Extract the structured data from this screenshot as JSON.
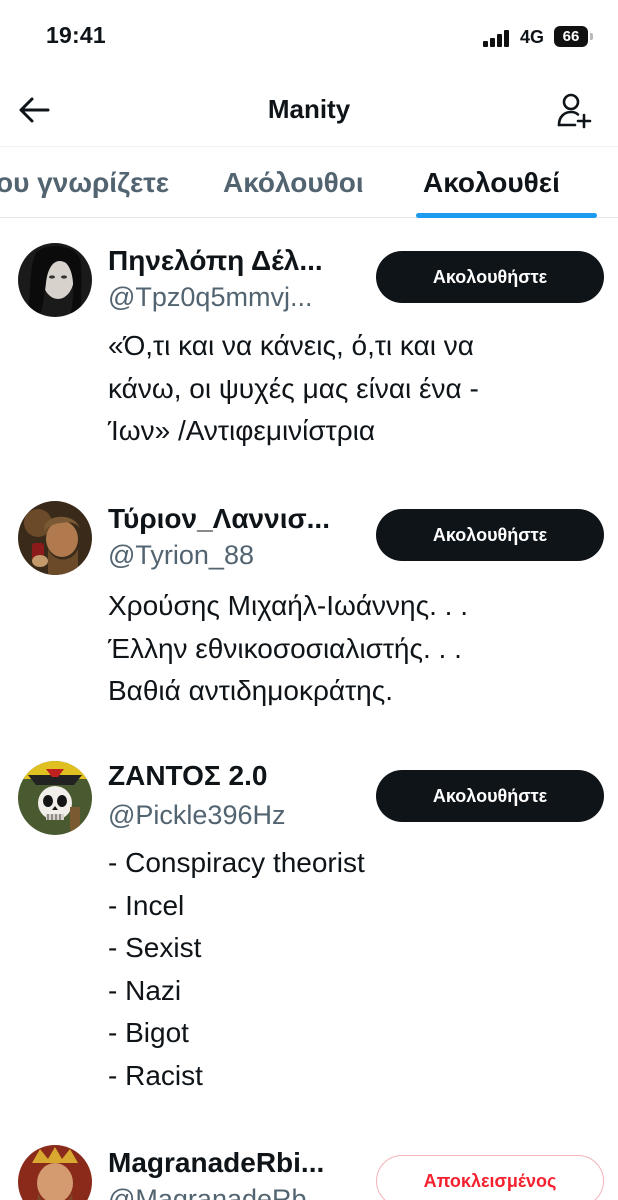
{
  "status_bar": {
    "time": "19:41",
    "network": "4G",
    "battery": "66"
  },
  "header": {
    "title": "Manity",
    "back_icon": "arrow-left-icon",
    "add_icon": "add-user-icon"
  },
  "tabs": [
    {
      "label": "ου γνωρίζετε",
      "active": false
    },
    {
      "label": "Ακόλουθοι",
      "active": false
    },
    {
      "label": "Ακολουθεί",
      "active": true
    }
  ],
  "colors": {
    "accent": "#1d9bf0",
    "text": "#0f1419",
    "muted": "#536471",
    "blocked": "#f4212e"
  },
  "users": [
    {
      "name": "Πηνελόπη Δέλ...",
      "handle": "@Tpz0q5mmvj...",
      "button": "Ακολουθήστε",
      "bio": [
        "«Ό,τι και να κάνεις, ό,τι και να",
        "κάνω, οι ψυχές μας είναι ένα -",
        "Ίων» /Αντιφεμινίστρια"
      ]
    },
    {
      "name": "Τύριον_Λαννισ...",
      "handle": "@Tyrion_88",
      "button": "Ακολουθήστε",
      "bio": [
        "Χρούσης Μιχαήλ-Ιωάννης. . .",
        "Έλλην εθνικοσοσιαλιστής. . .",
        "Βαθιά αντιδημοκράτης."
      ]
    },
    {
      "name": "ΖΑΝΤΟΣ 2.0",
      "handle": "@Pickle396Hz",
      "button": "Ακολουθήστε",
      "bio": [
        "- Conspiracy theorist",
        "- Incel",
        "- Sexist",
        "- Nazi",
        "- Bigot",
        "- Racist"
      ]
    },
    {
      "name": "MagranadeRbi...",
      "handle": "@MagranadeRb...",
      "button": "Αποκλεισμένος",
      "bio": []
    }
  ]
}
